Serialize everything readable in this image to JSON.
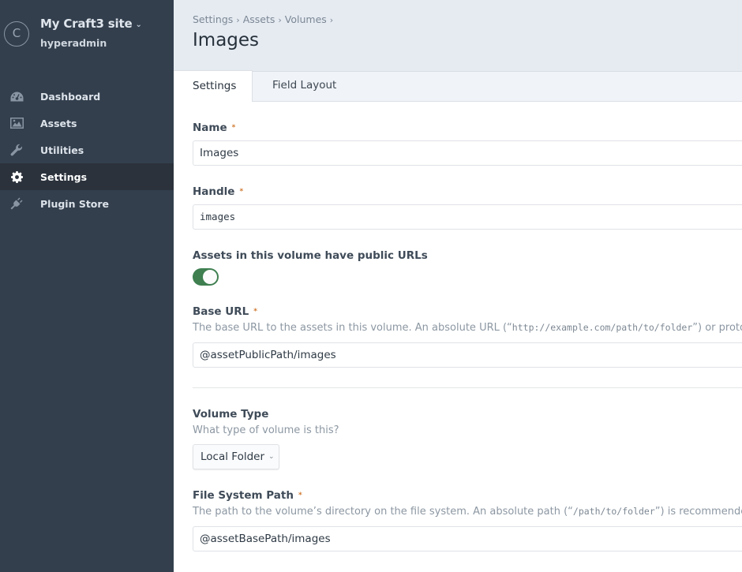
{
  "sidebar": {
    "site_logo_letter": "C",
    "site_name": "My Craft3 site",
    "site_chevron": "⌄",
    "username": "hyperadmin",
    "nav": [
      {
        "label": "Dashboard",
        "icon": "dashboard-gauge-icon",
        "active": false
      },
      {
        "label": "Assets",
        "icon": "image-icon",
        "active": false
      },
      {
        "label": "Utilities",
        "icon": "wrench-icon",
        "active": false
      },
      {
        "label": "Settings",
        "icon": "gear-icon",
        "active": true
      },
      {
        "label": "Plugin Store",
        "icon": "plug-icon",
        "active": false
      }
    ]
  },
  "header": {
    "breadcrumb": [
      "Settings",
      "Assets",
      "Volumes"
    ],
    "breadcrumb_separator": "›",
    "title": "Images"
  },
  "tabs": [
    {
      "label": "Settings",
      "active": true
    },
    {
      "label": "Field Layout",
      "active": false
    }
  ],
  "form": {
    "name": {
      "label": "Name",
      "required_marker": "*",
      "value": "Images"
    },
    "handle": {
      "label": "Handle",
      "required_marker": "*",
      "value": "images"
    },
    "public_urls": {
      "label": "Assets in this volume have public URLs",
      "enabled": true
    },
    "base_url": {
      "label": "Base URL",
      "required_marker": "*",
      "instructions_before": "The base URL to the assets in this volume. An absolute URL (“",
      "instructions_code": "http://example.com/path/to/folder",
      "instructions_after": "”) or proto",
      "value": "@assetPublicPath/images"
    },
    "volume_type": {
      "label": "Volume Type",
      "instructions": "What type of volume is this?",
      "selected": "Local Folder",
      "caret": "⌄"
    },
    "file_system_path": {
      "label": "File System Path",
      "required_marker": "*",
      "instructions_before": "The path to the volume’s directory on the file system. An absolute path (“",
      "instructions_code": "/path/to/folder",
      "instructions_after": "”) is recommended",
      "value": "@assetBasePath/images"
    }
  },
  "colors": {
    "sidebar_bg": "#333f4d",
    "sidebar_active_bg": "#2b323c",
    "header_bg": "#e6ebf2",
    "toggle_on": "#3f7f50",
    "required_marker": "#d0782f"
  }
}
